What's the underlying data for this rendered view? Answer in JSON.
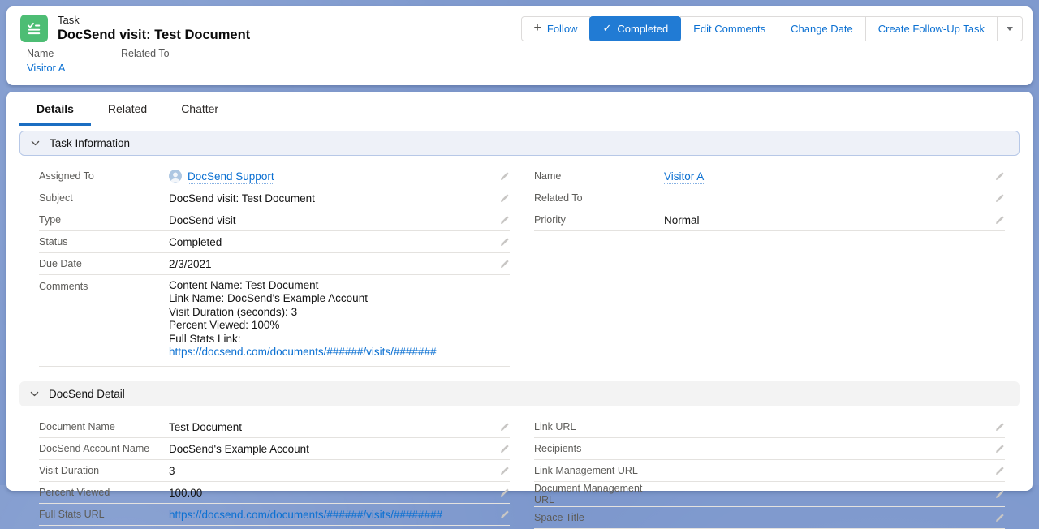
{
  "page": {
    "entity_label": "Task",
    "title": "DocSend visit: Test Document"
  },
  "actions": {
    "follow": "Follow",
    "completed": "Completed",
    "edit_comments": "Edit Comments",
    "change_date": "Change Date",
    "create_follow_up": "Create Follow-Up Task"
  },
  "highlights": {
    "name_label": "Name",
    "name_value": "Visitor A",
    "related_to_label": "Related To",
    "related_to_value": ""
  },
  "tabs": [
    {
      "label": "Details",
      "active": true
    },
    {
      "label": "Related",
      "active": false
    },
    {
      "label": "Chatter",
      "active": false
    }
  ],
  "sections": {
    "task_information": {
      "title": "Task Information",
      "left": [
        {
          "label": "Assigned To",
          "value": "DocSend Support",
          "type": "user-link"
        },
        {
          "label": "Subject",
          "value": "DocSend visit: Test Document"
        },
        {
          "label": "Type",
          "value": "DocSend visit"
        },
        {
          "label": "Status",
          "value": "Completed"
        },
        {
          "label": "Due Date",
          "value": "2/3/2021"
        },
        {
          "label": "Comments",
          "pencil": false,
          "comment_lines": [
            "Content Name: Test Document",
            "Link Name: DocSend's Example Account",
            "Visit Duration (seconds): 3",
            "Percent Viewed: 100%"
          ],
          "comment_link_prefix": "Full Stats Link: ",
          "comment_link": "https://docsend.com/documents/######/visits/#######"
        }
      ],
      "right": [
        {
          "label": "Name",
          "value": "Visitor A",
          "type": "lookup-link"
        },
        {
          "label": "Related To",
          "value": ""
        },
        {
          "label": "Priority",
          "value": "Normal"
        }
      ]
    },
    "docsend_detail": {
      "title": "DocSend Detail",
      "left": [
        {
          "label": "Document Name",
          "value": "Test Document"
        },
        {
          "label": "DocSend Account Name",
          "value": "DocSend's Example Account"
        },
        {
          "label": "Visit Duration",
          "value": "3"
        },
        {
          "label": "Percent Viewed",
          "value": "100.00"
        },
        {
          "label": "Full Stats URL",
          "value": "https://docsend.com/documents/######/visits/########",
          "type": "url-link"
        }
      ],
      "right": [
        {
          "label": "Link URL",
          "value": ""
        },
        {
          "label": "Recipients",
          "value": ""
        },
        {
          "label": "Link Management URL",
          "value": ""
        },
        {
          "label": "Document Management URL",
          "value": ""
        },
        {
          "label": "Space Title",
          "value": ""
        }
      ]
    }
  },
  "colors": {
    "brand_blue": "#0b70d2",
    "task_icon_green": "#4dbd74",
    "background_blue": "#7d98cd",
    "section_header_blue_bg": "#eef1f8",
    "section_header_gray_bg": "#f3f3f3"
  }
}
